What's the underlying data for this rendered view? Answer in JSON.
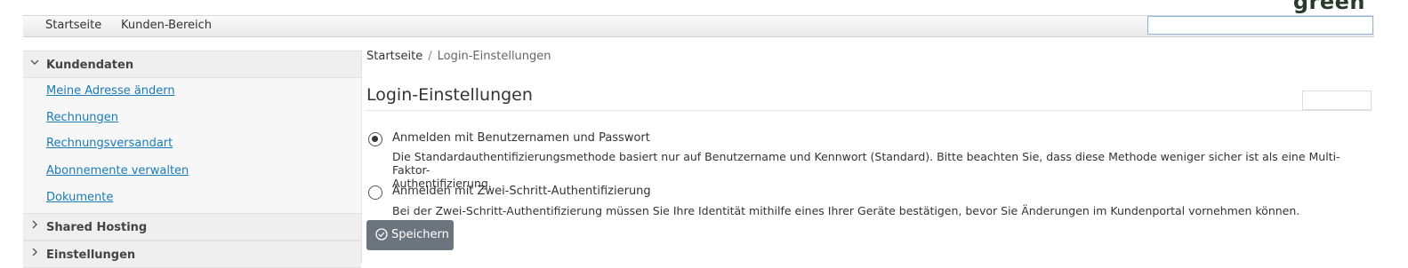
{
  "brand": {
    "logo_text": "green"
  },
  "topnav": {
    "items": [
      {
        "label": "Startseite"
      },
      {
        "label": "Kunden-Bereich"
      }
    ],
    "search_value": ""
  },
  "sidebar": {
    "sections": [
      {
        "title": "Kundendaten",
        "expanded": true,
        "links": [
          "Meine Adresse ändern",
          "Rechnungen",
          "Rechnungsversandart",
          "Abonnemente verwalten",
          "Dokumente"
        ]
      },
      {
        "title": "Shared Hosting",
        "expanded": false
      },
      {
        "title": "Einstellungen",
        "expanded": false
      }
    ]
  },
  "breadcrumb": {
    "home": "Startseite",
    "separator": "/",
    "current": "Login-Einstellungen"
  },
  "main": {
    "title": "Login-Einstellungen",
    "options": [
      {
        "label": "Anmelden mit Benutzernamen und Passwort",
        "selected": true,
        "description_line1": "Die Standardauthentifizierungsmethode basiert nur auf Benutzername und Kennwort (Standard). Bitte beachten Sie, dass diese Methode weniger sicher ist als eine Multi-Faktor-",
        "description_line2": "Authentifizierung."
      },
      {
        "label": "Anmelden mit Zwei-Schritt-Authentifizierung",
        "selected": false,
        "description_line1": "Bei der Zwei-Schritt-Authentifizierung müssen Sie Ihre Identität mithilfe eines Ihrer Geräte bestätigen, bevor Sie Änderungen im Kundenportal vornehmen können."
      }
    ],
    "save_label": "Speichern"
  },
  "colors": {
    "link": "#1a7bb9",
    "button": "#6c757d",
    "search_border": "#8fb4d9"
  }
}
